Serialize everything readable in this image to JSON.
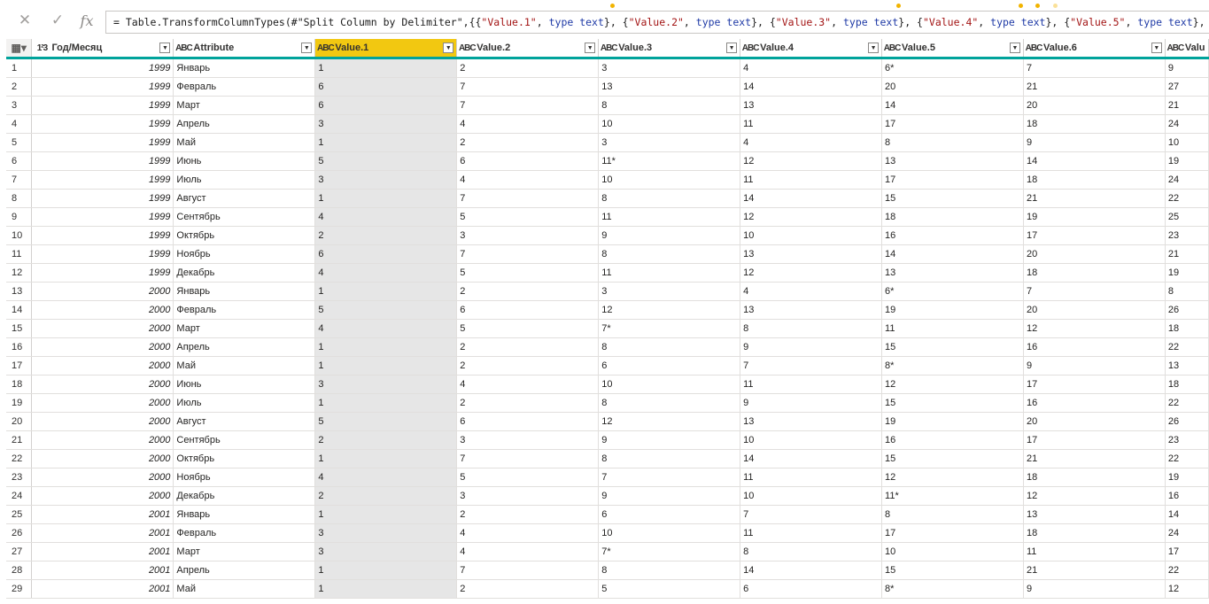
{
  "formula": {
    "prefix": "= Table.TransformColumnTypes(#\"Split Column by Delimiter\",{{",
    "parts": [
      {
        "s": "\"Value.1\"",
        "k": "type text"
      },
      {
        "s": "\"Value.2\"",
        "k": "type text"
      },
      {
        "s": "\"Value.3\"",
        "k": "type text"
      },
      {
        "s": "\"Value.4\"",
        "k": "type text"
      },
      {
        "s": "\"Value.5\"",
        "k": "type text"
      }
    ]
  },
  "columns": [
    {
      "type": "1²3",
      "label": "Год/Месяц"
    },
    {
      "type": "ABC",
      "label": "Attribute"
    },
    {
      "type": "ABC",
      "label": "Value.1",
      "selected": true
    },
    {
      "type": "ABC",
      "label": "Value.2"
    },
    {
      "type": "ABC",
      "label": "Value.3"
    },
    {
      "type": "ABC",
      "label": "Value.4"
    },
    {
      "type": "ABC",
      "label": "Value.5"
    },
    {
      "type": "ABC",
      "label": "Value.6"
    },
    {
      "type": "ABC",
      "label": "Valu"
    }
  ],
  "rows": [
    [
      "1999",
      "Январь",
      "1",
      "2",
      "3",
      "4",
      "6*",
      "7",
      "9"
    ],
    [
      "1999",
      "Февраль",
      "6",
      "7",
      "13",
      "14",
      "20",
      "21",
      "27"
    ],
    [
      "1999",
      "Март",
      "6",
      "7",
      "8",
      "13",
      "14",
      "20",
      "21"
    ],
    [
      "1999",
      "Апрель",
      "3",
      "4",
      "10",
      "11",
      "17",
      "18",
      "24"
    ],
    [
      "1999",
      "Май",
      "1",
      "2",
      "3",
      "4",
      "8",
      "9",
      "10"
    ],
    [
      "1999",
      "Июнь",
      "5",
      "6",
      "11*",
      "12",
      "13",
      "14",
      "19"
    ],
    [
      "1999",
      "Июль",
      "3",
      "4",
      "10",
      "11",
      "17",
      "18",
      "24"
    ],
    [
      "1999",
      "Август",
      "1",
      "7",
      "8",
      "14",
      "15",
      "21",
      "22"
    ],
    [
      "1999",
      "Сентябрь",
      "4",
      "5",
      "11",
      "12",
      "18",
      "19",
      "25"
    ],
    [
      "1999",
      "Октябрь",
      "2",
      "3",
      "9",
      "10",
      "16",
      "17",
      "23"
    ],
    [
      "1999",
      "Ноябрь",
      "6",
      "7",
      "8",
      "13",
      "14",
      "20",
      "21"
    ],
    [
      "1999",
      "Декабрь",
      "4",
      "5",
      "11",
      "12",
      "13",
      "18",
      "19"
    ],
    [
      "2000",
      "Январь",
      "1",
      "2",
      "3",
      "4",
      "6*",
      "7",
      "8"
    ],
    [
      "2000",
      "Февраль",
      "5",
      "6",
      "12",
      "13",
      "19",
      "20",
      "26"
    ],
    [
      "2000",
      "Март",
      "4",
      "5",
      "7*",
      "8",
      "11",
      "12",
      "18"
    ],
    [
      "2000",
      "Апрель",
      "1",
      "2",
      "8",
      "9",
      "15",
      "16",
      "22"
    ],
    [
      "2000",
      "Май",
      "1",
      "2",
      "6",
      "7",
      "8*",
      "9",
      "13"
    ],
    [
      "2000",
      "Июнь",
      "3",
      "4",
      "10",
      "11",
      "12",
      "17",
      "18"
    ],
    [
      "2000",
      "Июль",
      "1",
      "2",
      "8",
      "9",
      "15",
      "16",
      "22"
    ],
    [
      "2000",
      "Август",
      "5",
      "6",
      "12",
      "13",
      "19",
      "20",
      "26"
    ],
    [
      "2000",
      "Сентябрь",
      "2",
      "3",
      "9",
      "10",
      "16",
      "17",
      "23"
    ],
    [
      "2000",
      "Октябрь",
      "1",
      "7",
      "8",
      "14",
      "15",
      "21",
      "22"
    ],
    [
      "2000",
      "Ноябрь",
      "4",
      "5",
      "7",
      "11",
      "12",
      "18",
      "19"
    ],
    [
      "2000",
      "Декабрь",
      "2",
      "3",
      "9",
      "10",
      "11*",
      "12",
      "16"
    ],
    [
      "2001",
      "Январь",
      "1",
      "2",
      "6",
      "7",
      "8",
      "13",
      "14"
    ],
    [
      "2001",
      "Февраль",
      "3",
      "4",
      "10",
      "11",
      "17",
      "18",
      "24"
    ],
    [
      "2001",
      "Март",
      "3",
      "4",
      "7*",
      "8",
      "10",
      "11",
      "17"
    ],
    [
      "2001",
      "Апрель",
      "1",
      "7",
      "8",
      "14",
      "15",
      "21",
      "22"
    ],
    [
      "2001",
      "Май",
      "1",
      "2",
      "5",
      "6",
      "8*",
      "9",
      "12"
    ]
  ],
  "colors": {
    "accent": "#00a39b",
    "selected_header": "#f2c811",
    "selected_column": "#e6e6e6"
  }
}
